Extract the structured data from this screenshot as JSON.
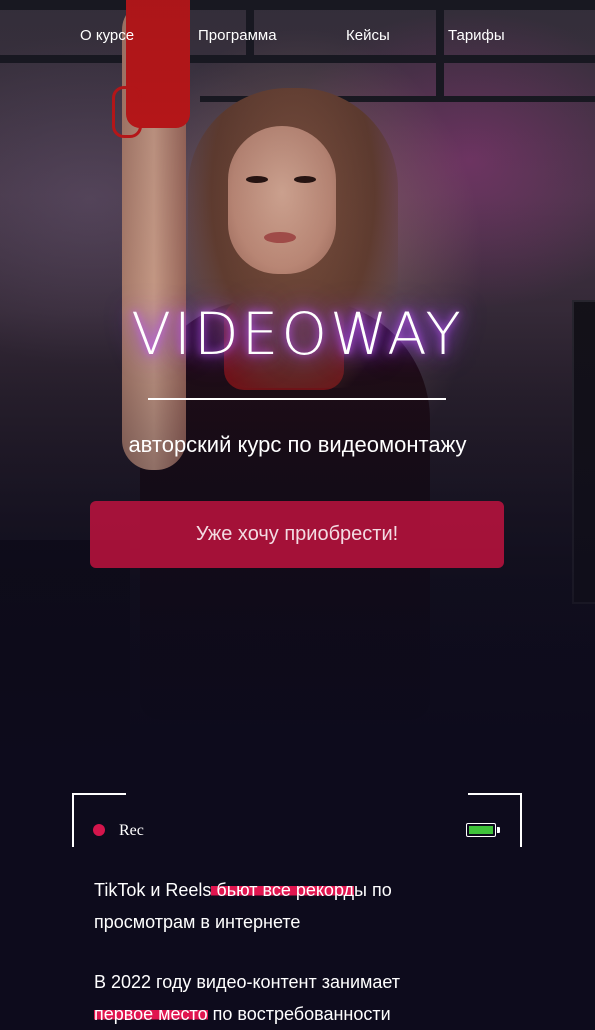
{
  "nav": {
    "items": [
      "О курсе",
      "Программа",
      "Кейсы",
      "Тарифы"
    ]
  },
  "hero": {
    "logo": "VIDEOWAY",
    "subtitle": "авторский курс по видеомонтажу",
    "cta_label": "Уже хочу приобрести!"
  },
  "rec": {
    "label": "Rec",
    "battery_level": 1.0,
    "dot_icon": "record-dot-icon",
    "battery_icon": "battery-icon"
  },
  "content": {
    "p1_a": "TikTok и Reels",
    "p1_hl": " бьют все рекорд",
    "p1_b": "ы по",
    "p1_line2": "просмотрам в интернете",
    "p2_line1": "В 2022 году видео-контент занимает",
    "p2_hl": "первое место",
    "p2_b": " по востребованности"
  },
  "colors": {
    "accent": "#c51240",
    "highlight": "#e0154f",
    "logo_glow": "#a03cff",
    "battery": "#3fc23a",
    "background": "#0d0b1c"
  }
}
